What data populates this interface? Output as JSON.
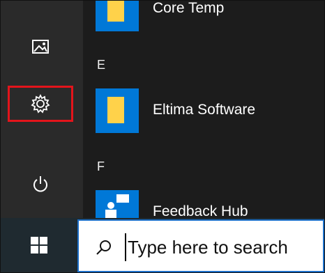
{
  "apps": [
    {
      "label": "Core Temp"
    },
    {
      "label": "Eltima Software"
    },
    {
      "label": "Feedback Hub"
    }
  ],
  "letters": [
    "E",
    "F"
  ],
  "rail": {
    "pictures_icon": "pictures-icon",
    "settings_icon": "gear-icon",
    "power_icon": "power-icon"
  },
  "taskbar": {
    "start_icon": "windows-logo-icon",
    "search_placeholder": "Type here to search"
  },
  "colors": {
    "tile_blue": "#0078d7",
    "folder_yellow": "#ffd24a",
    "highlight_red": "#e3141b",
    "search_border": "#1b6fc9"
  }
}
